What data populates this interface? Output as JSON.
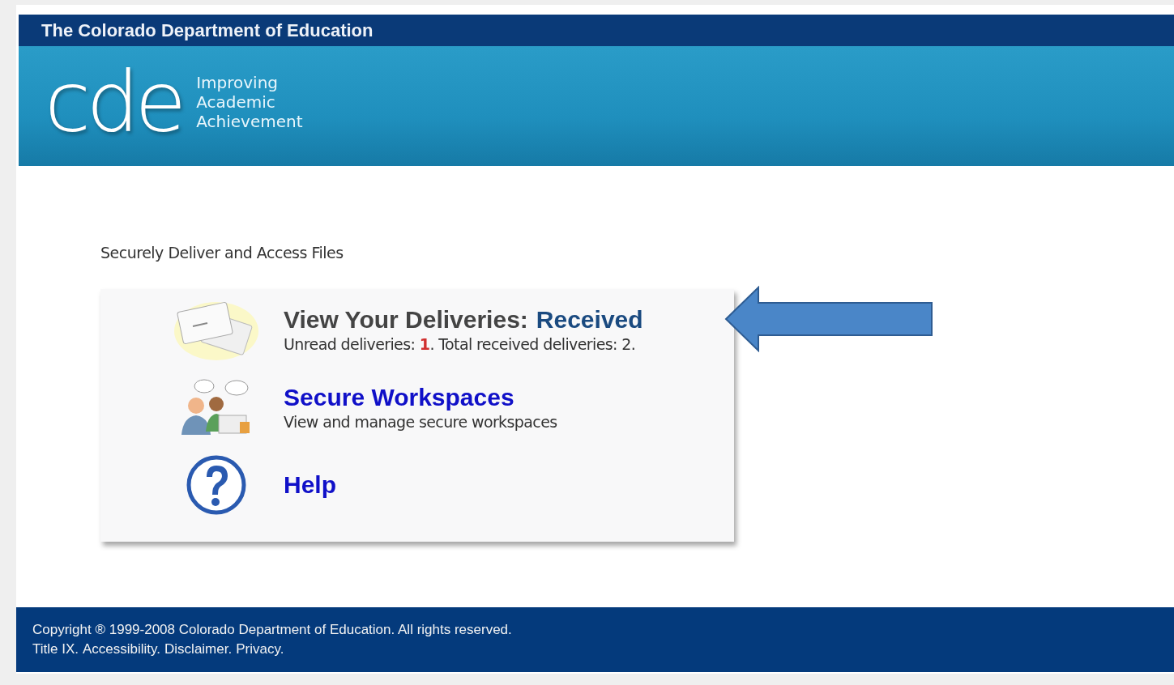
{
  "header": {
    "title": "The Colorado Department of Education",
    "logo": "cde",
    "tagline": [
      "Improving",
      "Academic",
      "Achievement"
    ]
  },
  "intro": "Securely Deliver and Access Files",
  "items": [
    {
      "kind": "deliveries",
      "title": "View Your Deliveries:",
      "link": "Received",
      "description": "Unread deliveries: **1**. Total received deliveries: 2."
    },
    {
      "kind": "workspaces",
      "link": "Secure Workspaces",
      "description": "View and manage secure workspaces"
    },
    {
      "kind": "help",
      "link": "Help"
    }
  ],
  "footer": {
    "copyright": "Copyright ® 1999-2008 Colorado Department of Education. All rights reserved.",
    "links": [
      "Title IX.",
      "Accessibility.",
      "Disclaimer.",
      "Privacy."
    ]
  }
}
